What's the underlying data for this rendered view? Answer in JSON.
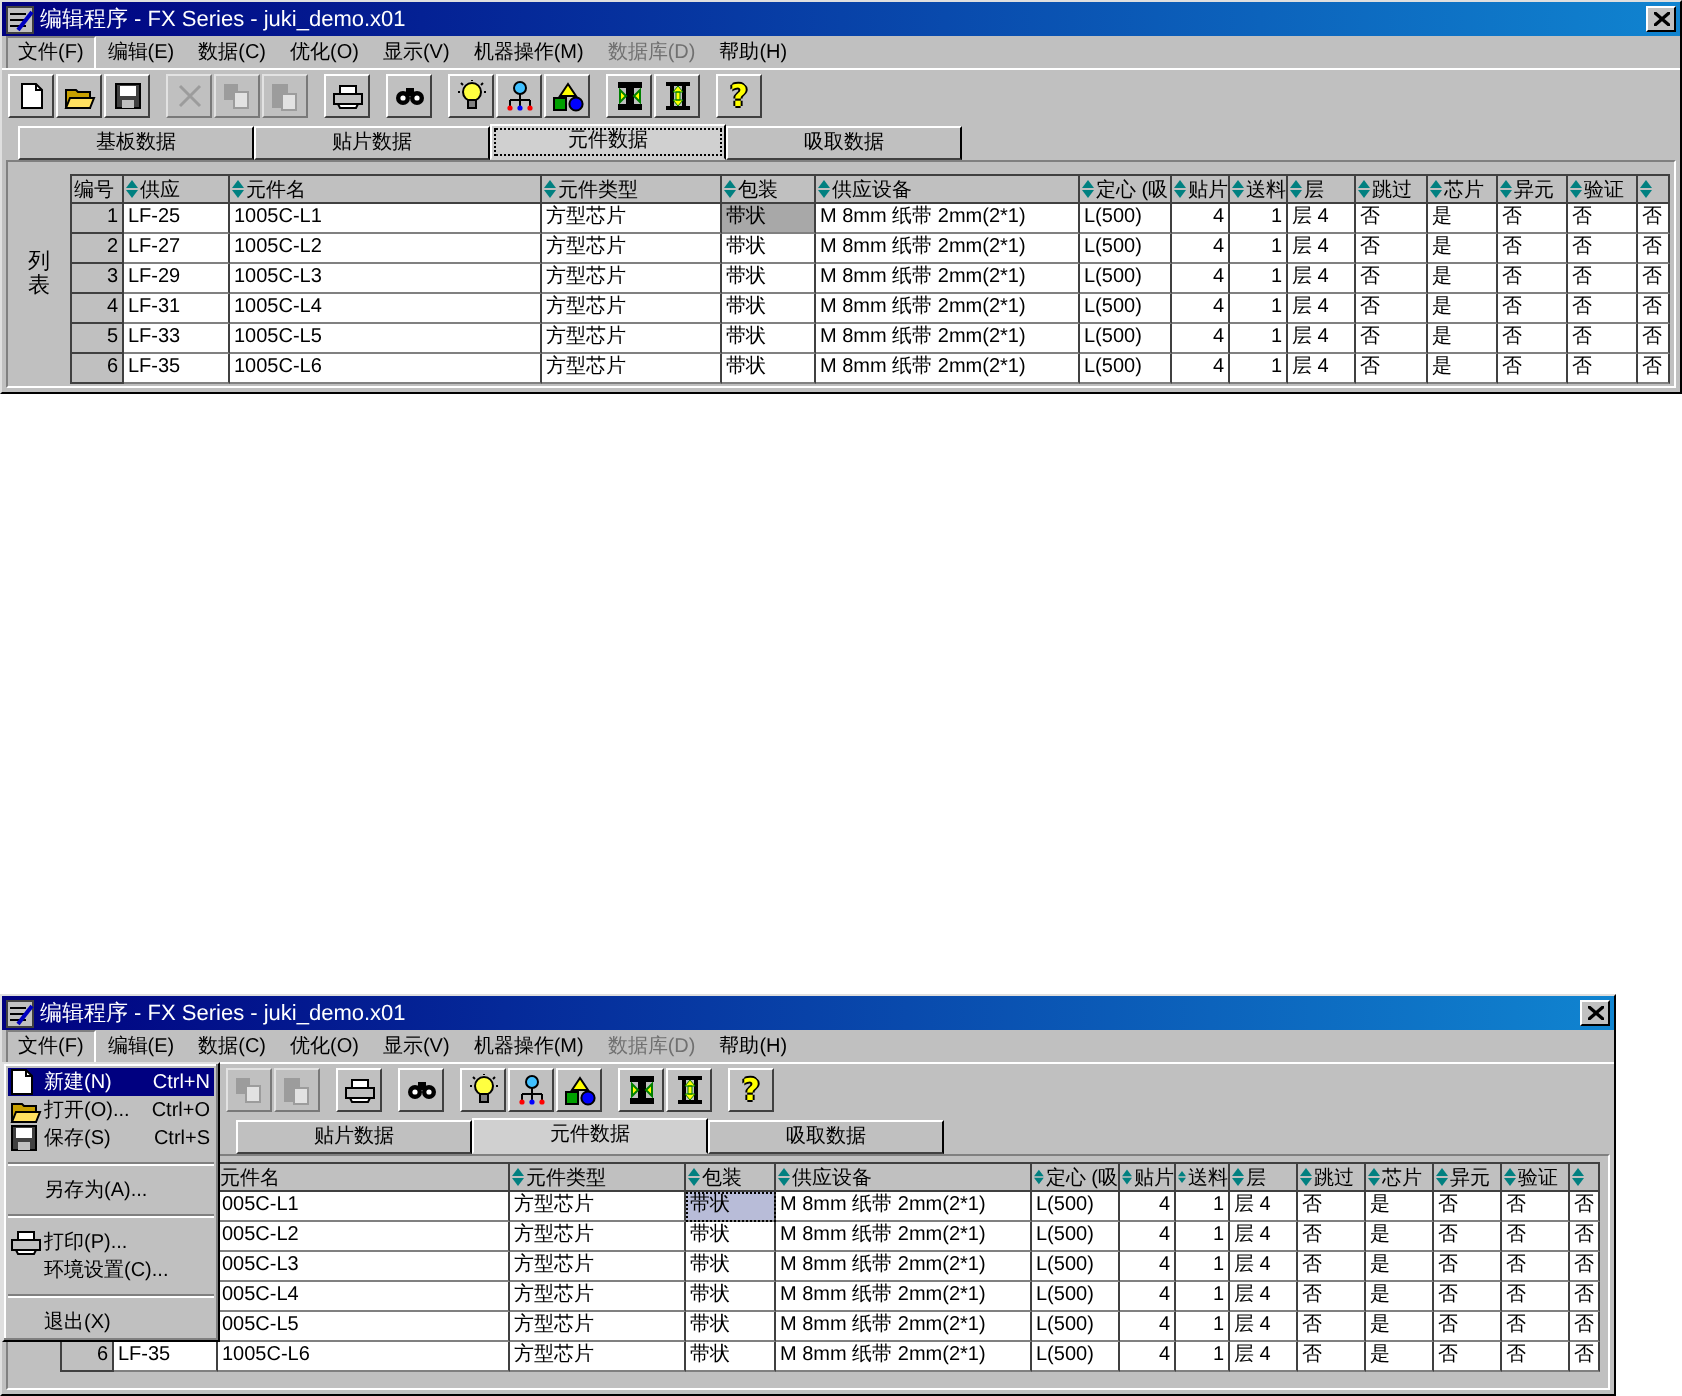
{
  "windows": [
    {
      "title": "编辑程序 - FX Series - juki_demo.x01",
      "menu": [
        {
          "label": "文件(F)",
          "selected": true,
          "disabled": false
        },
        {
          "label": "编辑(E)",
          "selected": false,
          "disabled": false
        },
        {
          "label": "数据(C)",
          "selected": false,
          "disabled": false
        },
        {
          "label": "优化(O)",
          "selected": false,
          "disabled": false
        },
        {
          "label": "显示(V)",
          "selected": false,
          "disabled": false
        },
        {
          "label": "机器操作(M)",
          "selected": false,
          "disabled": false
        },
        {
          "label": "数据库(D)",
          "selected": false,
          "disabled": true
        },
        {
          "label": "帮助(H)",
          "selected": false,
          "disabled": false
        }
      ],
      "toolbar": [
        [
          {
            "kind": "new",
            "disabled": false
          },
          {
            "kind": "open",
            "disabled": false
          },
          {
            "kind": "save",
            "disabled": false
          }
        ],
        [
          {
            "kind": "cut",
            "disabled": true
          },
          {
            "kind": "copy",
            "disabled": true
          },
          {
            "kind": "paste",
            "disabled": true
          }
        ],
        [
          {
            "kind": "print",
            "disabled": false
          }
        ],
        [
          {
            "kind": "find",
            "disabled": false
          }
        ],
        [
          {
            "kind": "bulb",
            "disabled": false
          },
          {
            "kind": "network",
            "disabled": false
          },
          {
            "kind": "shapes",
            "disabled": false
          }
        ],
        [
          {
            "kind": "swap",
            "disabled": false
          },
          {
            "kind": "height",
            "disabled": false
          }
        ],
        [
          {
            "kind": "help",
            "glyph": "?",
            "disabled": false
          }
        ]
      ],
      "tabs": [
        {
          "label": "基板数据",
          "selected": false,
          "focused": false
        },
        {
          "label": "贴片数据",
          "selected": false,
          "focused": false
        },
        {
          "label": "元件数据",
          "selected": true,
          "focused": true
        },
        {
          "label": "吸取数据",
          "selected": false,
          "focused": false
        }
      ],
      "side_label": "列表",
      "table": {
        "columns": [
          {
            "label": "编号",
            "sortable": false
          },
          {
            "label": "供应",
            "sortable": true
          },
          {
            "label": "元件名",
            "sortable": true
          },
          {
            "label": "元件类型",
            "sortable": true
          },
          {
            "label": "包装",
            "sortable": true
          },
          {
            "label": "供应设备",
            "sortable": true
          },
          {
            "label": "定心 (吸",
            "sortable": true
          },
          {
            "label": "贴片",
            "sortable": true
          },
          {
            "label": "送料",
            "sortable": true
          },
          {
            "label": "层",
            "sortable": true
          },
          {
            "label": "跳过",
            "sortable": true
          },
          {
            "label": "芯片",
            "sortable": true
          },
          {
            "label": "异元",
            "sortable": true
          },
          {
            "label": "验证",
            "sortable": true
          },
          {
            "sortable": true
          }
        ],
        "rows": [
          {
            "cells": [
              "1",
              "LF-25",
              "1005C-L1",
              "方型芯片",
              {
                "text": "带状",
                "selected": true
              },
              "M 8mm 纸带 2mm(2*1)",
              "L(500)",
              "4",
              "1",
              "层 4",
              "否",
              "是",
              "否",
              "否",
              "否"
            ]
          },
          {
            "cells": [
              "2",
              "LF-27",
              "1005C-L2",
              "方型芯片",
              {
                "text": "带状",
                "selected": false
              },
              "M 8mm 纸带 2mm(2*1)",
              "L(500)",
              "4",
              "1",
              "层 4",
              "否",
              "是",
              "否",
              "否",
              "否"
            ]
          },
          {
            "cells": [
              "3",
              "LF-29",
              "1005C-L3",
              "方型芯片",
              {
                "text": "带状",
                "selected": false
              },
              "M 8mm 纸带 2mm(2*1)",
              "L(500)",
              "4",
              "1",
              "层 4",
              "否",
              "是",
              "否",
              "否",
              "否"
            ]
          },
          {
            "cells": [
              "4",
              "LF-31",
              "1005C-L4",
              "方型芯片",
              {
                "text": "带状",
                "selected": false
              },
              "M 8mm 纸带 2mm(2*1)",
              "L(500)",
              "4",
              "1",
              "层 4",
              "否",
              "是",
              "否",
              "否",
              "否"
            ]
          },
          {
            "cells": [
              "5",
              "LF-33",
              "1005C-L5",
              "方型芯片",
              {
                "text": "带状",
                "selected": false
              },
              "M 8mm 纸带 2mm(2*1)",
              "L(500)",
              "4",
              "1",
              "层 4",
              "否",
              "是",
              "否",
              "否",
              "否"
            ]
          },
          {
            "cells": [
              "6",
              "LF-35",
              "1005C-L6",
              "方型芯片",
              {
                "text": "带状",
                "selected": false
              },
              "M 8mm 纸带 2mm(2*1)",
              "L(500)",
              "4",
              "1",
              "层 4",
              "否",
              "是",
              "否",
              "否",
              "否"
            ]
          }
        ]
      }
    },
    {
      "title": "编辑程序 - FX Series - juki_demo.x01",
      "menu": [
        {
          "label": "文件(F)",
          "selected": true,
          "disabled": false
        },
        {
          "label": "编辑(E)",
          "selected": false,
          "disabled": false
        },
        {
          "label": "数据(C)",
          "selected": false,
          "disabled": false
        },
        {
          "label": "优化(O)",
          "selected": false,
          "disabled": false
        },
        {
          "label": "显示(V)",
          "selected": false,
          "disabled": false
        },
        {
          "label": "机器操作(M)",
          "selected": false,
          "disabled": false
        },
        {
          "label": "数据库(D)",
          "selected": false,
          "disabled": true
        },
        {
          "label": "帮助(H)",
          "selected": false,
          "disabled": false
        }
      ],
      "open_menu": [
        {
          "kind": "new",
          "label": "新建(N)",
          "shortcut": "Ctrl+N",
          "selected": true
        },
        {
          "kind": "open",
          "label": "打开(O)...",
          "shortcut": "Ctrl+O",
          "selected": false
        },
        {
          "kind": "save",
          "label": "保存(S)",
          "shortcut": "Ctrl+S",
          "selected": false
        },
        {
          "kind": "separator"
        },
        {
          "kind": "plain",
          "label": "另存为(A)...",
          "selected": false
        },
        {
          "kind": "separator"
        },
        {
          "kind": "print",
          "label": "打印(P)...",
          "selected": false
        },
        {
          "kind": "plain",
          "label": "环境设置(C)...",
          "selected": false
        },
        {
          "kind": "separator"
        },
        {
          "kind": "plain",
          "label": "退出(X)",
          "selected": false
        }
      ],
      "toolbar": [
        [
          {
            "kind": "copy",
            "disabled": true
          },
          {
            "kind": "paste",
            "disabled": true
          }
        ],
        [
          {
            "kind": "print",
            "disabled": false
          }
        ],
        [
          {
            "kind": "find",
            "disabled": false
          }
        ],
        [
          {
            "kind": "bulb",
            "disabled": false
          },
          {
            "kind": "network",
            "disabled": false
          },
          {
            "kind": "shapes",
            "disabled": false
          }
        ],
        [
          {
            "kind": "swap",
            "disabled": false
          },
          {
            "kind": "height",
            "disabled": false
          }
        ],
        [
          {
            "kind": "help",
            "glyph": "?",
            "disabled": false
          }
        ]
      ],
      "tabs": [
        {
          "label": "贴片数据",
          "selected": false,
          "focused": false
        },
        {
          "label": "元件数据",
          "selected": true,
          "focused": false
        },
        {
          "label": "吸取数据",
          "selected": false,
          "focused": false
        }
      ],
      "table": {
        "columns": [
          {},
          {},
          {
            "label": "元件名",
            "sortable": false
          },
          {
            "label": "元件类型",
            "sortable": true
          },
          {
            "label": "包装",
            "sortable": true
          },
          {
            "label": "供应设备",
            "sortable": true
          },
          {
            "label": "定心 (吸",
            "sortable": true
          },
          {
            "label": "贴片",
            "sortable": true
          },
          {
            "label": "送料",
            "sortable": true
          },
          {
            "label": "层",
            "sortable": true
          },
          {
            "label": "跳过",
            "sortable": true
          },
          {
            "label": "芯片",
            "sortable": true
          },
          {
            "label": "异元",
            "sortable": true
          },
          {
            "label": "验证",
            "sortable": true
          },
          {
            "sortable": true
          }
        ],
        "rows": [
          {
            "cells": [
              null,
              null,
              "005C-L1",
              "方型芯片",
              {
                "text": "带状",
                "selected": true
              },
              "M 8mm 纸带 2mm(2*1)",
              "L(500)",
              "4",
              "1",
              "层 4",
              "否",
              "是",
              "否",
              "否",
              "否"
            ]
          },
          {
            "cells": [
              null,
              null,
              "005C-L2",
              "方型芯片",
              {
                "text": "带状",
                "selected": false
              },
              "M 8mm 纸带 2mm(2*1)",
              "L(500)",
              "4",
              "1",
              "层 4",
              "否",
              "是",
              "否",
              "否",
              "否"
            ]
          },
          {
            "cells": [
              null,
              null,
              "005C-L3",
              "方型芯片",
              {
                "text": "带状",
                "selected": false
              },
              "M 8mm 纸带 2mm(2*1)",
              "L(500)",
              "4",
              "1",
              "层 4",
              "否",
              "是",
              "否",
              "否",
              "否"
            ]
          },
          {
            "cells": [
              null,
              null,
              "005C-L4",
              "方型芯片",
              {
                "text": "带状",
                "selected": false
              },
              "M 8mm 纸带 2mm(2*1)",
              "L(500)",
              "4",
              "1",
              "层 4",
              "否",
              "是",
              "否",
              "否",
              "否"
            ]
          },
          {
            "cells": [
              null,
              null,
              "005C-L5",
              "方型芯片",
              {
                "text": "带状",
                "selected": false
              },
              "M 8mm 纸带 2mm(2*1)",
              "L(500)",
              "4",
              "1",
              "层 4",
              "否",
              "是",
              "否",
              "否",
              "否"
            ]
          },
          {
            "cells": [
              "6",
              "LF-35",
              "1005C-L6",
              "方型芯片",
              {
                "text": "带状",
                "selected": false
              },
              "M 8mm 纸带 2mm(2*1)",
              "L(500)",
              "4",
              "1",
              "层 4",
              "否",
              "是",
              "否",
              "否",
              "否"
            ]
          }
        ]
      }
    }
  ]
}
